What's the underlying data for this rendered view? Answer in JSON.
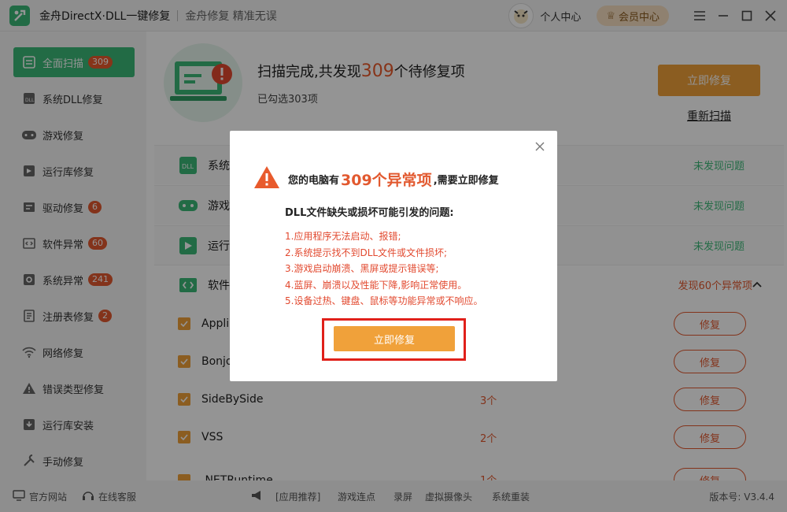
{
  "app": {
    "title": "金舟DirectX·DLL一键修复",
    "slogan": "金舟修复 精准无误"
  },
  "header": {
    "personal": "个人中心",
    "vip": "会员中心"
  },
  "sidebar": {
    "items": [
      {
        "label": "全面扫描",
        "badge": "309",
        "icon": "scan-icon"
      },
      {
        "label": "系统DLL修复",
        "badge": "",
        "icon": "dll-icon"
      },
      {
        "label": "游戏修复",
        "badge": "",
        "icon": "gamepad-icon"
      },
      {
        "label": "运行库修复",
        "badge": "",
        "icon": "runtime-icon"
      },
      {
        "label": "驱动修复",
        "badge": "6",
        "icon": "driver-icon"
      },
      {
        "label": "软件异常",
        "badge": "60",
        "icon": "software-icon"
      },
      {
        "label": "系统异常",
        "badge": "241",
        "icon": "system-gear-icon"
      },
      {
        "label": "注册表修复",
        "badge": "2",
        "icon": "registry-icon"
      },
      {
        "label": "网络修复",
        "badge": "",
        "icon": "wifi-icon"
      },
      {
        "label": "错误类型修复",
        "badge": "",
        "icon": "warning-icon"
      },
      {
        "label": "运行库安装",
        "badge": "",
        "icon": "install-icon"
      },
      {
        "label": "手动修复",
        "badge": "",
        "icon": "tools-icon"
      }
    ]
  },
  "scan": {
    "head_pre": "扫描完成,共发现",
    "count": "309",
    "head_post": "个待修复项",
    "selected": "已勾选303项",
    "fix_now": "立即修复",
    "rescan": "重新扫描"
  },
  "categories": [
    {
      "name": "系统",
      "status": "未发现问题"
    },
    {
      "name": "游戏",
      "status": "未发现问题"
    },
    {
      "name": "运行",
      "status": "未发现问题"
    },
    {
      "name": "软件",
      "status": "发现60个异常项"
    }
  ],
  "items": [
    {
      "name": "Appli",
      "count": "",
      "action": "修复"
    },
    {
      "name": "Bonjo",
      "count": "",
      "action": "修复"
    },
    {
      "name": "SideBySide",
      "count": "3个",
      "action": "修复"
    },
    {
      "name": "VSS",
      "count": "2个",
      "action": "修复"
    },
    {
      "name": ".NETRuntime",
      "count": "1个",
      "action": "修复"
    }
  ],
  "bottom": {
    "site": "官方网站",
    "service": "在线客服",
    "links": [
      "[应用推荐]",
      "游戏连点",
      "录屏",
      "虚拟摄像头",
      "系统重装"
    ],
    "version": "版本号: V3.4.4"
  },
  "modal": {
    "head_pre": "您的电脑有",
    "count": "309个异常项",
    "head_post": ",需要立即修复",
    "subtitle": "DLL文件缺失或损坏可能引发的问题:",
    "problems": [
      "1.应用程序无法启动、报错;",
      "2.系统提示找不到DLL文件或文件损坏;",
      "3.游戏启动崩溃、黑屏或提示错误等;",
      "4.蓝屏、崩溃以及性能下降,影响正常使用。",
      "5.设备过热、键盘、鼠标等功能异常或不响应。"
    ],
    "button": "立即修复"
  },
  "colors": {
    "green": "#3cb878",
    "orange": "#f0a13a",
    "red": "#e2592f",
    "highlight": "#e0201a"
  }
}
